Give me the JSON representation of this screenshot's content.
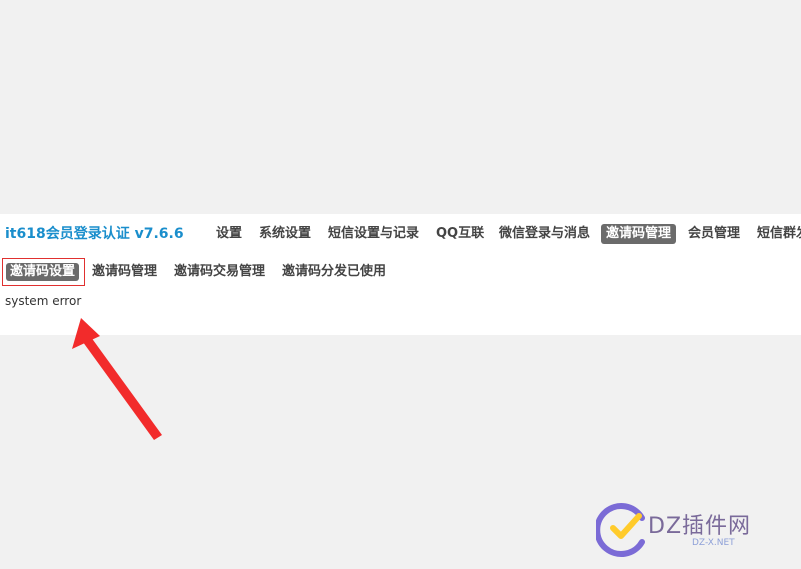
{
  "app": {
    "title": "it618会员登录认证 v7.6.6"
  },
  "nav": {
    "items": [
      {
        "label": "设置"
      },
      {
        "label": "系统设置"
      },
      {
        "label": "短信设置与记录"
      },
      {
        "label": "QQ互联"
      },
      {
        "label": "微信登录与消息"
      },
      {
        "label": "邀请码管理",
        "active": true
      },
      {
        "label": "会员管理"
      },
      {
        "label": "短信群发"
      }
    ]
  },
  "subnav": {
    "items": [
      {
        "label": "邀请码设置",
        "active": true
      },
      {
        "label": "邀请码管理"
      },
      {
        "label": "邀请码交易管理"
      },
      {
        "label": "邀请码分发已使用"
      }
    ]
  },
  "content": {
    "error": "system error"
  },
  "watermark": {
    "brand": "DZ插件网",
    "url": "DZ-X.NET"
  },
  "colors": {
    "accent": "#1a8ecc",
    "active_bg": "#6b6b6b",
    "annotation": "#e0302f"
  }
}
